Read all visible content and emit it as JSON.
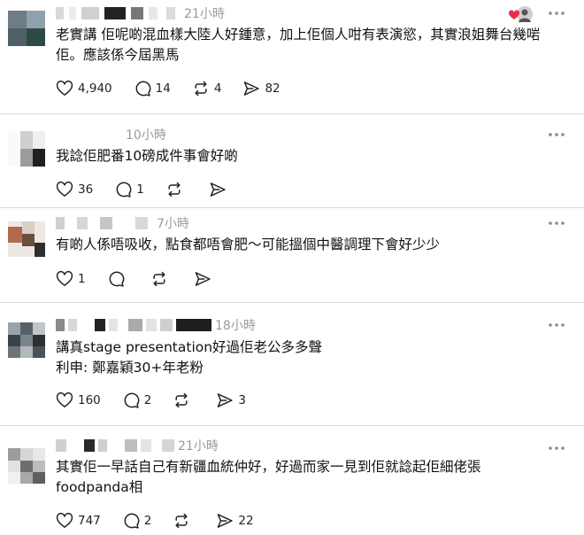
{
  "comments": [
    {
      "time": "21小時",
      "lines": [
        "老實講 佢呢啲混血樣大陸人好鍾意，加上佢個人咁有表演慾，其實浪姐舞台幾啱",
        "佢。應該係今屆黑馬"
      ],
      "likes": "4,940",
      "replies": "14",
      "reposts": "4",
      "shares": "82"
    },
    {
      "time": "10小時",
      "lines": [
        "我諗佢肥番10磅成件事會好啲"
      ],
      "likes": "36",
      "replies": "1",
      "reposts": "",
      "shares": ""
    },
    {
      "time": "7小時",
      "lines": [
        "有啲人係唔吸收，點食都唔會肥～可能搵個中醫調理下會好少少"
      ],
      "likes": "1",
      "replies": "",
      "reposts": "",
      "shares": ""
    },
    {
      "time": "18小時",
      "lines": [
        "講真stage presentation好過佢老公多多聲",
        "利申: 鄭嘉穎30+年老粉"
      ],
      "likes": "160",
      "replies": "2",
      "reposts": "",
      "shares": "3"
    },
    {
      "time": "21小時",
      "lines": [
        "其實佢一早話自己有新疆血統仲好，好過而家一見到佢就諗起佢細佬張",
        "foodpanda相"
      ],
      "likes": "747",
      "replies": "2",
      "reposts": "",
      "shares": "22"
    }
  ],
  "icons": {
    "like": "heart-icon",
    "reply": "speech-bubble-icon",
    "repost": "repost-arrows-icon",
    "share": "send-icon",
    "more": "more-dots-icon",
    "liked_by_author": "liked-by-author-avatar-icon"
  },
  "colors": {
    "background": "#ffffff",
    "text": "#111111",
    "muted": "#9a9a9a",
    "divider": "#d9d9d9",
    "liked_heart": "#ee2a4b"
  }
}
